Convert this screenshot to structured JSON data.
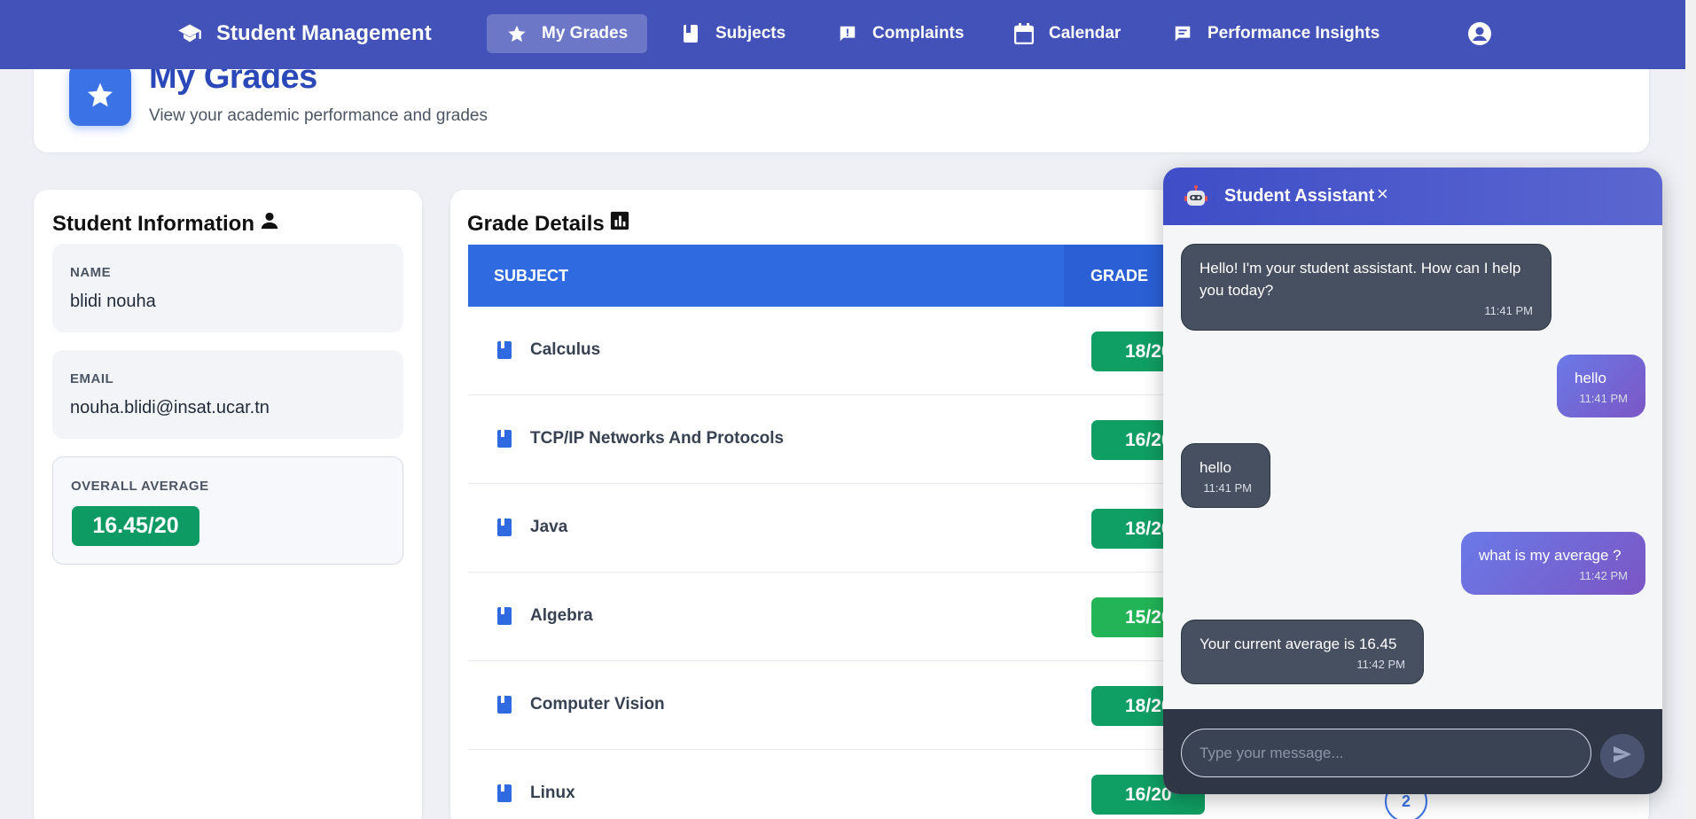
{
  "nav": {
    "brand": "Student Management",
    "items": [
      {
        "label": "My Grades",
        "icon": "star-icon",
        "active": true
      },
      {
        "label": "Subjects",
        "icon": "book-icon"
      },
      {
        "label": "Complaints",
        "icon": "report-icon"
      },
      {
        "label": "Calendar",
        "icon": "calendar-icon"
      },
      {
        "label": "Performance Insights",
        "icon": "chat-icon"
      }
    ],
    "profile_icon": "account-circle-icon"
  },
  "header": {
    "title": "My Grades",
    "subtitle": "View your academic performance and grades"
  },
  "student_info": {
    "title": "Student Information",
    "name_label": "NAME",
    "name": "blidi nouha",
    "email_label": "EMAIL",
    "email": "nouha.blidi@insat.ucar.tn",
    "average_label": "OVERALL AVERAGE",
    "average": "16.45/20"
  },
  "grades": {
    "title": "Grade Details",
    "columns": [
      "SUBJECT",
      "GRADE"
    ],
    "rows": [
      {
        "subject": "Calculus",
        "grade": "18/20"
      },
      {
        "subject": "TCP/IP Networks And Protocols",
        "grade": "16/20"
      },
      {
        "subject": "Java",
        "grade": "18/20"
      },
      {
        "subject": "Algebra",
        "grade": "15/20"
      },
      {
        "subject": "Computer Vision",
        "grade": "18/20"
      },
      {
        "subject": "Linux",
        "grade": "16/20"
      }
    ],
    "page_partial": "2"
  },
  "chat": {
    "title": "Student Assistant",
    "close": "×",
    "messages": [
      {
        "from": "bot",
        "text": "Hello! I'm your student assistant. How can I help you today?",
        "time": "11:41 PM"
      },
      {
        "from": "user",
        "text": "hello",
        "time": "11:41 PM"
      },
      {
        "from": "bot",
        "text": "hello",
        "time": "11:41 PM"
      },
      {
        "from": "user",
        "text": "what is my average ?",
        "time": "11:42 PM"
      },
      {
        "from": "bot",
        "text": "Your current average is 16.45",
        "time": "11:42 PM"
      }
    ],
    "input_placeholder": "Type your message..."
  },
  "colors": {
    "nav_bg": "#4352b8",
    "accent_blue": "#2f6ae0",
    "grade_green": "#0f9e63",
    "grade_green_light": "#22b456",
    "chat_bot_bubble": "#475060"
  }
}
